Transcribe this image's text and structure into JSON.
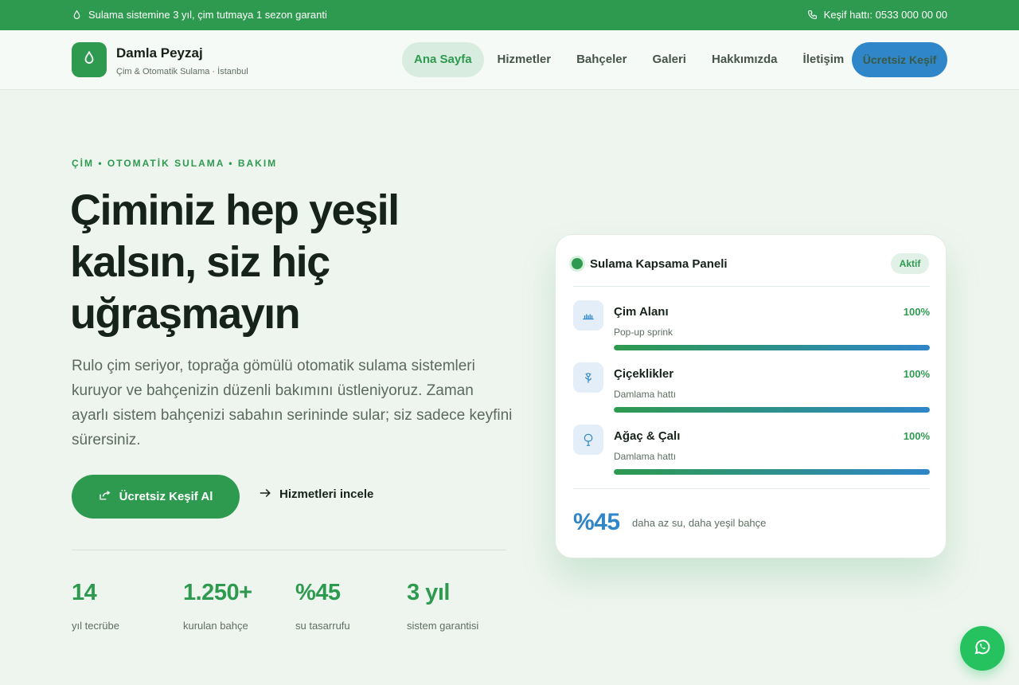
{
  "topbar": {
    "promo": "Sulama sistemine 3 yıl, çim tutmaya 1 sezon garanti",
    "phone": "Keşif hattı: 0533 000 00 00"
  },
  "header": {
    "brand_name": "Damla Peyzaj",
    "brand_tagline": "Çim & Otomatik Sulama · İstanbul",
    "nav": [
      {
        "label": "Ana Sayfa",
        "active": true
      },
      {
        "label": "Hizmetler",
        "active": false
      },
      {
        "label": "Bahçeler",
        "active": false
      },
      {
        "label": "Galeri",
        "active": false
      },
      {
        "label": "Hakkımızda",
        "active": false
      },
      {
        "label": "İletişim",
        "active": false
      }
    ],
    "cta": "Ücretsiz Keşif"
  },
  "hero": {
    "eyebrow": "ÇİM • OTOMATİK SULAMA • BAKIM",
    "title": "Çiminiz hep yeşil kalsın, siz hiç uğraşmayın",
    "description": "Rulo çim seriyor, toprağa gömülü otomatik sulama sistemleri kuruyor ve bahçenizin düzenli bakımını üstleniyoruz. Zaman ayarlı sistem bahçenizi sabahın serininde sular; siz sadece keyfini sürersiniz.",
    "primary_button": "Ücretsiz Keşif Al",
    "secondary_link": "Hizmetleri incele",
    "stats": [
      {
        "value": "14",
        "label": "yıl tecrübe"
      },
      {
        "value": "1.250+",
        "label": "kurulan bahçe"
      },
      {
        "value": "%45",
        "label": "su tasarrufu"
      },
      {
        "value": "3 yıl",
        "label": "sistem garantisi"
      }
    ]
  },
  "panel": {
    "title": "Sulama Kapsama Paneli",
    "badge": "Aktif",
    "zones": [
      {
        "name": "Çim Alanı",
        "type": "Pop-up sprink",
        "percent_label": "100%",
        "coverage": 1.0,
        "icon": "grass-icon"
      },
      {
        "name": "Çiçeklikler",
        "type": "Damlama hattı",
        "percent_label": "100%",
        "coverage": 1.0,
        "icon": "flower-icon"
      },
      {
        "name": "Ağaç & Çalı",
        "type": "Damlama hattı",
        "percent_label": "100%",
        "coverage": 1.0,
        "icon": "tree-icon"
      }
    ],
    "saving_value": "%45",
    "saving_note": "daha az su, daha yeşil bahçe"
  },
  "colors": {
    "brand_green": "#2e9a4f",
    "accent_blue": "#2f86c8",
    "whatsapp_green": "#25c25f"
  }
}
